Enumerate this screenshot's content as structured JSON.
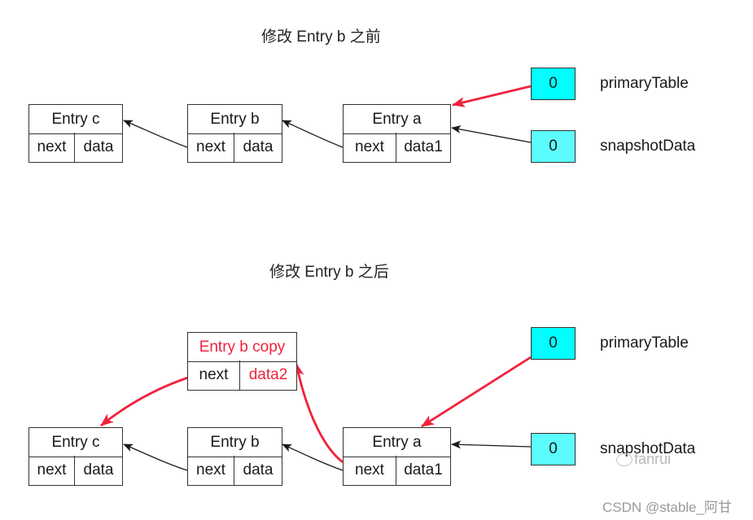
{
  "colors": {
    "pointer_fill_primary": "#00ffff",
    "pointer_fill_snapshot": "#5cfcfc",
    "highlight_red": "#f0233c",
    "line_black": "#1a1a1a"
  },
  "before": {
    "title": "修改 Entry b 之前",
    "nodes": {
      "entry_c": {
        "title": "Entry c",
        "next": "next",
        "data": "data"
      },
      "entry_b": {
        "title": "Entry b",
        "next": "next",
        "data": "data"
      },
      "entry_a": {
        "title": "Entry a",
        "next": "next",
        "data": "data1"
      }
    },
    "pointers": {
      "primary": {
        "value": "0",
        "label": "primaryTable"
      },
      "snapshot": {
        "value": "0",
        "label": "snapshotData"
      }
    }
  },
  "after": {
    "title": "修改 Entry b 之后",
    "nodes": {
      "entry_b_copy": {
        "title": "Entry b copy",
        "next": "next",
        "data": "data2"
      },
      "entry_c": {
        "title": "Entry c",
        "next": "next",
        "data": "data"
      },
      "entry_b": {
        "title": "Entry b",
        "next": "next",
        "data": "data"
      },
      "entry_a": {
        "title": "Entry a",
        "next": "next",
        "data": "data1"
      }
    },
    "pointers": {
      "primary": {
        "value": "0",
        "label": "primaryTable"
      },
      "snapshot": {
        "value": "0",
        "label": "snapshotData"
      }
    }
  },
  "watermarks": {
    "wechat": "fanrui",
    "csdn": "CSDN @stable_阿甘"
  }
}
